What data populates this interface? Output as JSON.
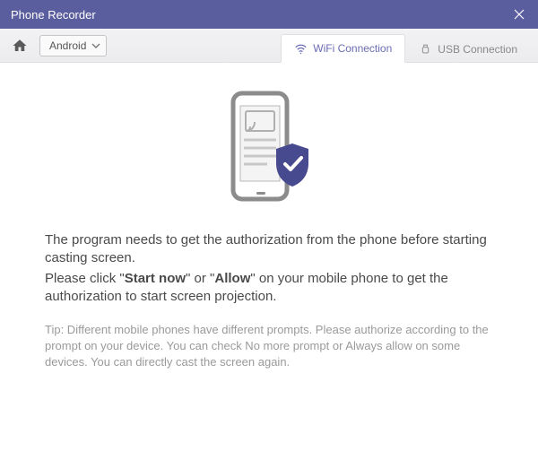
{
  "window": {
    "title": "Phone Recorder"
  },
  "toolbar": {
    "platform_selected": "Android"
  },
  "tabs": {
    "wifi": {
      "label": "WiFi Connection"
    },
    "usb": {
      "label": "USB Connection"
    }
  },
  "content": {
    "line1": "The program needs to get the authorization from the phone before starting casting screen.",
    "line2_prefix": "Please click \"",
    "line2_strong1": "Start now",
    "line2_mid": "\" or \"",
    "line2_strong2": "Allow",
    "line2_suffix": "\" on your mobile phone to get the authorization to start screen projection.",
    "tip": "Tip: Different mobile phones have different prompts. Please authorize according to the prompt on your device. You can check No more prompt or Always allow on some devices. You can directly cast the screen again."
  },
  "colors": {
    "accent": "#5b5e9e",
    "shield": "#474a8e"
  }
}
